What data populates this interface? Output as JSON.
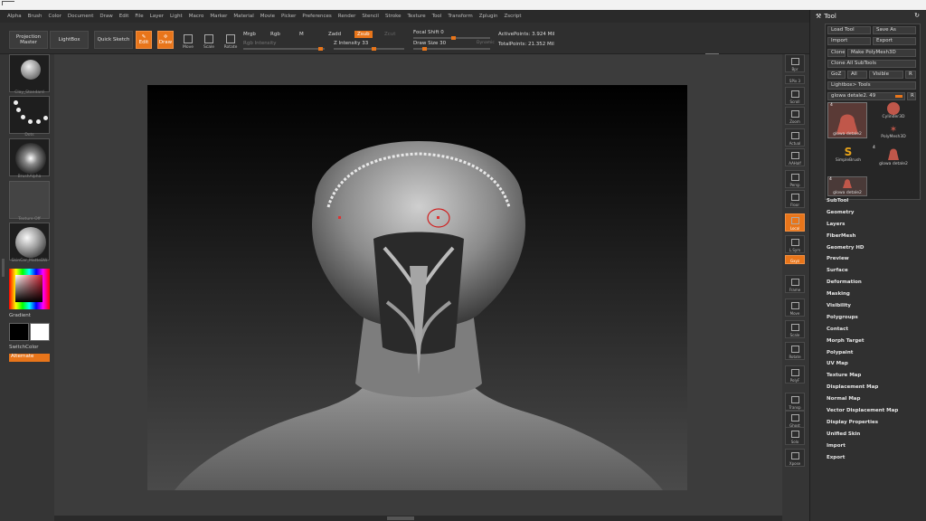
{
  "menu": [
    "Alpha",
    "Brush",
    "Color",
    "Document",
    "Draw",
    "Edit",
    "File",
    "Layer",
    "Light",
    "Macro",
    "Marker",
    "Material",
    "Movie",
    "Picker",
    "Preferences",
    "Render",
    "Stencil",
    "Stroke",
    "Texture",
    "Tool",
    "Transform",
    "Zplugin",
    "Zscript"
  ],
  "toolbar": {
    "projection_master": "Projection Master",
    "lightbox": "LightBox",
    "quick_sketch": "Quick Sketch",
    "edit": "Edit",
    "draw": "Draw",
    "move": "Move",
    "scale": "Scale",
    "rotate": "Rotate",
    "mrgb": "Mrgb",
    "rgb": "Rgb",
    "m": "M",
    "rgb_intensity": "Rgb Intensity",
    "zadd": "Zadd",
    "zsub": "Zsub",
    "zcut": "Zcut",
    "z_intensity": "Z Intensity 33",
    "focal_shift": "Focal Shift 0",
    "draw_size": "Draw Size 30",
    "dynamic": "Dynamic",
    "active_points": "ActivePoints: 3.924 Mil",
    "total_points": "TotalPoints: 21.352 Mil"
  },
  "left_shelf": {
    "brush_label": "Clay_Standard",
    "stroke_label": "Dots",
    "alpha_label": "BrushAlpha",
    "texture_label": "Texture Off",
    "material_label": "SkinCar_MatteBW",
    "gradient": "Gradient",
    "switch_color": "SwitchColor",
    "alternate": "Alternate"
  },
  "right_shelf": {
    "buttons": [
      "Bpr",
      "SPix 3",
      "Scroll",
      "Zoom",
      "Actual",
      "AAHalf",
      "Persp",
      "Floor",
      "Local",
      "L.Sym",
      "Gxyz",
      "Frame",
      "Move",
      "Scale",
      "Rotate",
      "PolyF",
      "Transp",
      "Ghost",
      "Solo",
      "Xpose"
    ]
  },
  "tool_palette": {
    "title": "Tool",
    "load_tool": "Load Tool",
    "save_as": "Save As",
    "import": "Import",
    "export": "Export",
    "clone": "Clone",
    "make_polymesh": "Make PolyMesh3D",
    "clone_all": "Clone All SubTools",
    "goz": "GoZ",
    "all": "All",
    "visible": "Visible",
    "r": "R",
    "lightbox_tools": "Lightbox> Tools",
    "current_tool": "glowa detale2. 49",
    "tools": [
      {
        "name": "glowa detale2",
        "count": "4"
      },
      {
        "name": "Cylinder3D",
        "count": ""
      },
      {
        "name": "PolyMesh3D",
        "count": ""
      },
      {
        "name": "SimpleBrush",
        "count": ""
      },
      {
        "name": "glowa detale2",
        "count": "4"
      },
      {
        "name": "glowa detale2",
        "count": "4"
      }
    ],
    "sections": [
      "SubTool",
      "Geometry",
      "Layers",
      "FiberMesh",
      "Geometry HD",
      "Preview",
      "Surface",
      "Deformation",
      "Masking",
      "Visibility",
      "Polygroups",
      "Contact",
      "Morph Target",
      "Polypaint",
      "UV Map",
      "Texture Map",
      "Displacement Map",
      "Normal Map",
      "Vector Displacement Map",
      "Display Properties",
      "Unified Skin",
      "Import",
      "Export"
    ]
  },
  "colors": {
    "accent": "#e8751a",
    "primary_color": "#000000",
    "secondary_color": "#ffffff"
  }
}
